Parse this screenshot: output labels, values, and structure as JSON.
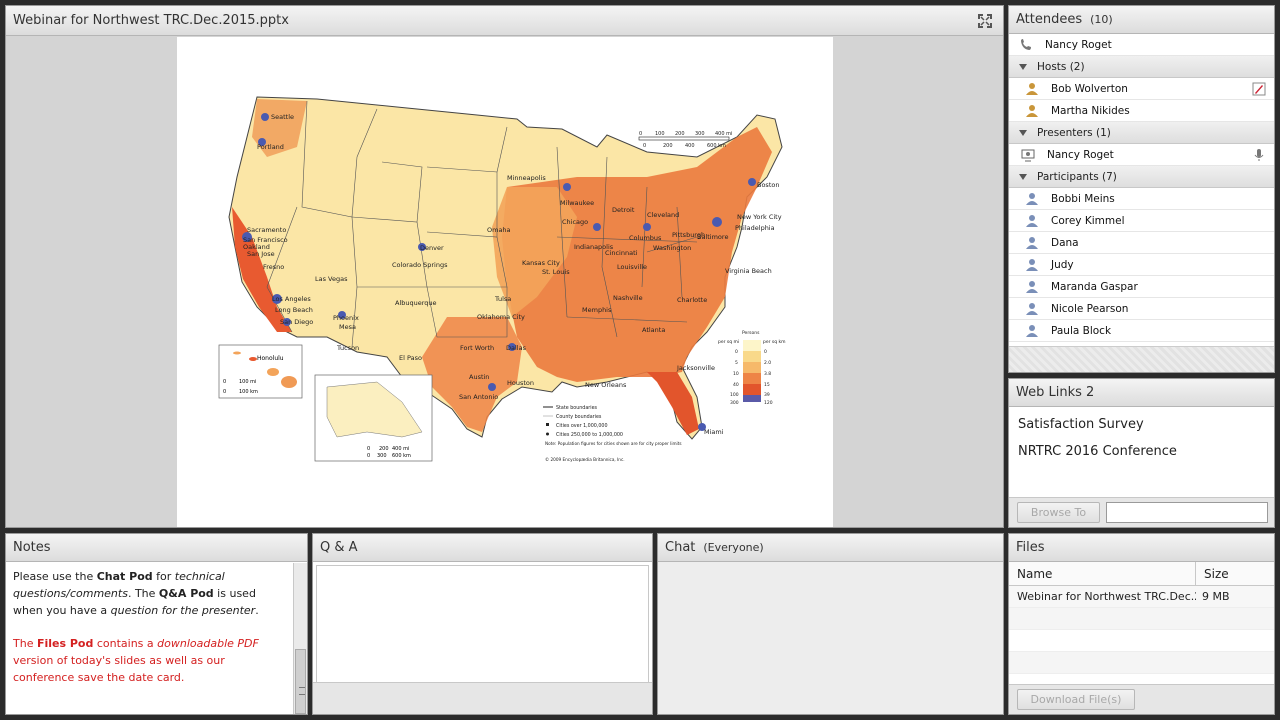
{
  "share": {
    "title": "Webinar for Northwest TRC.Dec.2015.pptx",
    "slide": {
      "map_labels": {
        "cities": [
          "Seattle",
          "Portland",
          "Sacramento",
          "San Francisco",
          "Oakland",
          "San Jose",
          "Fresno",
          "Los Angeles",
          "Long Beach",
          "San Diego",
          "Las Vegas",
          "Phoenix",
          "Mesa",
          "Tucson",
          "Denver",
          "Colorado Springs",
          "Albuquerque",
          "El Paso",
          "Minneapolis",
          "Milwaukee",
          "Chicago",
          "Detroit",
          "Cleveland",
          "Columbus",
          "Indianapolis",
          "Cincinnati",
          "Pittsburgh",
          "Philadelphia",
          "New York City",
          "Boston",
          "Baltimore",
          "Washington",
          "Virginia Beach",
          "Charlotte",
          "Nashville",
          "Memphis",
          "Atlanta",
          "Jacksonville",
          "Miami",
          "New Orleans",
          "Houston",
          "San Antonio",
          "Austin",
          "Dallas",
          "Fort Worth",
          "Oklahoma City",
          "Tulsa",
          "Kansas City",
          "St. Louis",
          "Omaha",
          "Louisville",
          "Honolulu"
        ],
        "scale_miles": [
          "0",
          "100",
          "200",
          "300",
          "400 mi"
        ],
        "scale_km": [
          "0",
          "200",
          "400",
          "600 km"
        ],
        "alaska_scale_miles": [
          "0",
          "200",
          "400 mi"
        ],
        "alaska_scale_km": [
          "0",
          "300",
          "600 km"
        ],
        "hawaii_scale_miles": [
          "0",
          "100 mi"
        ],
        "hawaii_scale_km": [
          "0",
          "100 km"
        ],
        "legend_title": "Persons",
        "legend_left_units": "per sq mi",
        "legend_right_units": "per sq km",
        "legend_left_values": [
          "0",
          "5",
          "10",
          "40",
          "100",
          "300"
        ],
        "legend_right_values": [
          "0",
          "2.0",
          "3.8",
          "15",
          "39",
          "120"
        ],
        "legend_items": [
          "State boundaries",
          "County boundaries",
          "Cities over 1,000,000",
          "Cities 250,000 to 1,000,000"
        ],
        "note": "Note: Population figures for cities shown are for city proper limits",
        "copyright": "© 2009 Encyclopædia Britannica, Inc."
      }
    }
  },
  "attendees": {
    "title": "Attendees",
    "count": "(10)",
    "me": "Nancy Roget",
    "groups": [
      {
        "label": "Hosts (2)",
        "people": [
          "Bob Wolverton",
          "Martha  Nikides"
        ]
      },
      {
        "label": "Presenters (1)",
        "people": [
          "Nancy Roget"
        ]
      },
      {
        "label": "Participants (7)",
        "people": [
          "Bobbi Meins",
          "Corey Kimmel",
          "Dana",
          "Judy",
          "Maranda Gaspar",
          "Nicole Pearson",
          "Paula Block"
        ]
      }
    ]
  },
  "weblinks": {
    "title": "Web Links 2",
    "links": [
      "Satisfaction Survey",
      "NRTRC 2016 Conference"
    ],
    "browse_label": "Browse To"
  },
  "notes": {
    "title": "Notes",
    "p1": {
      "a": "Please use the ",
      "b": "Chat Pod",
      "c": " for ",
      "d": "technical questions/comments",
      "e": ". The ",
      "f": "Q&A Pod",
      "g": " is used when you have a ",
      "h": "question for the presenter",
      "i": "."
    },
    "p2": {
      "a": "The ",
      "b": "Files Pod",
      "c": " contains a ",
      "d": "downloadable PDF",
      "e": " version of today's slides as well as our conference save the date card."
    }
  },
  "qa": {
    "title": "Q & A"
  },
  "chat": {
    "title": "Chat",
    "scope": "(Everyone)"
  },
  "files": {
    "title": "Files",
    "columns": [
      "Name",
      "Size"
    ],
    "rows": [
      {
        "name": "Webinar for Northwest TRC.Dec.2015.pptx",
        "size": "9 MB"
      }
    ],
    "download_label": "Download File(s)"
  },
  "colors": {
    "map_low": "#fdf5c9",
    "map_mid": "#f6b96a",
    "map_high": "#e2552c",
    "map_top": "#5a5aa8",
    "disabled_text": "#a8a8a8",
    "red_text": "#d42020"
  }
}
